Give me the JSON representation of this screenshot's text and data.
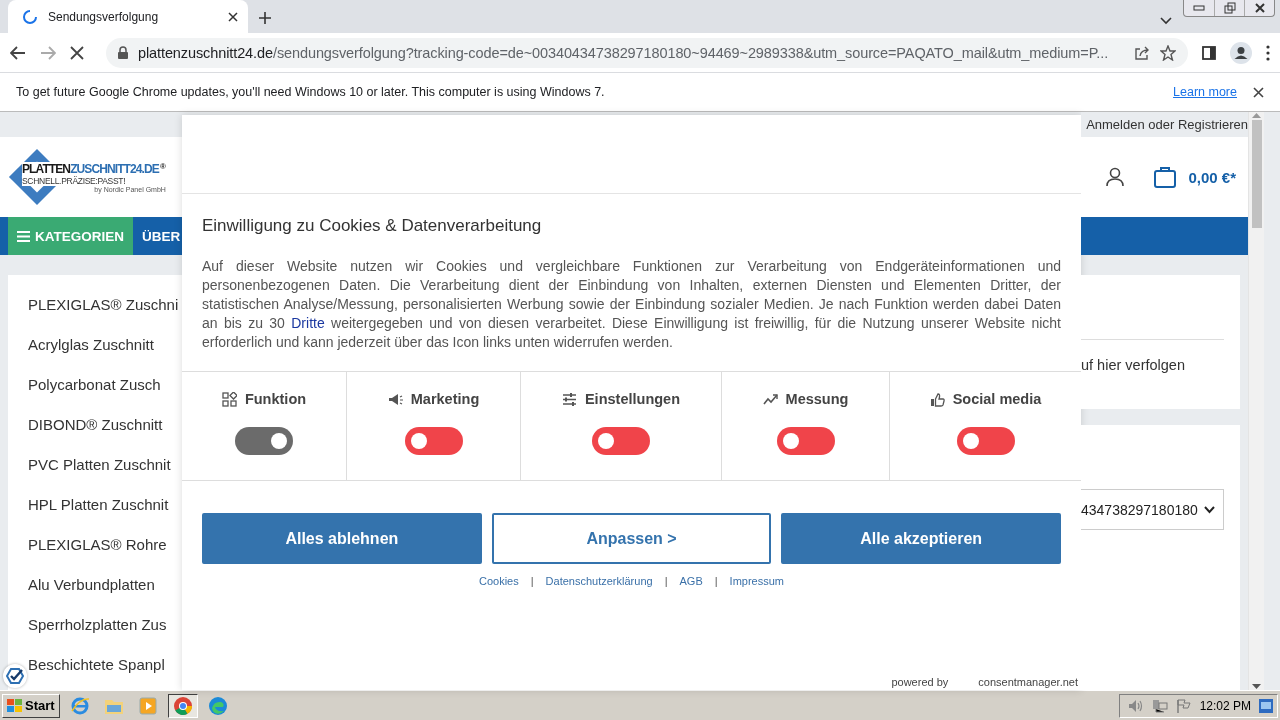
{
  "browser": {
    "tab": {
      "title": "Sendungsverfolgung",
      "loading": true
    },
    "address": {
      "host": "plattenzuschnitt24.de",
      "path": "/sendungsverfolgung?tracking-code=de~00340434738297180180~94469~2989338&utm_source=PAQATO_mail&utm_medium=P..."
    },
    "infobar": {
      "message": "To get future Google Chrome updates, you'll need Windows 10 or later. This computer is using Windows 7.",
      "link": "Learn more"
    }
  },
  "site": {
    "top_link": "Anmelden oder Registrieren",
    "logo": {
      "name_dark": "PLATTEN",
      "name_blue": "ZUSCHNITT24.DE",
      "mark": "®",
      "slogan": "SCHNELL.PRÄZISE:PASST!",
      "byline": "by Nordic Panel GmbH"
    },
    "cart_total": "0,00 €*",
    "nav": [
      {
        "label": "KATEGORIEN",
        "kind": "menu"
      },
      {
        "label": "ÜBER",
        "kind": "link"
      }
    ],
    "sidebar": [
      "PLEXIGLAS® Zuschni",
      "Acrylglas Zuschnitt",
      "Polycarbonat Zusch",
      "DIBOND® Zuschnitt",
      "PVC Platten Zuschnit",
      "HPL Platten Zuschnit",
      "PLEXIGLAS® Rohre",
      "Alu Verbundplatten",
      "Sperrholzplatten Zus",
      "Beschichtete Spanpl"
    ],
    "tracking_text": "uf hier verfolgen",
    "tracking_select": "434738297180180"
  },
  "consent": {
    "title": "Einwilligung zu Cookies & Datenverarbeitung",
    "body": {
      "before": "Auf dieser Website nutzen wir Cookies und vergleichbare Funktionen zur Verarbeitung von Endgeräteinformationen und personenbezogenen Daten. Die Verarbeitung dient der Einbindung von Inhalten, externen Diensten und Elementen Dritter, der statistischen Analyse/Messung, personalisierten Werbung sowie der Einbindung sozialer Medien. Je nach Funktion werden dabei Daten an bis zu 30 ",
      "link": "Dritte",
      "after": " weitergegeben und von diesen verarbeitet. Diese Einwilligung ist freiwillig, für die Nutzung unserer Website nicht erforderlich und kann jederzeit über das Icon links unten widerrufen werden."
    },
    "categories": [
      {
        "label": "Funktion",
        "on": true
      },
      {
        "label": "Marketing",
        "on": false
      },
      {
        "label": "Einstellungen",
        "on": false
      },
      {
        "label": "Messung",
        "on": false
      },
      {
        "label": "Social media",
        "on": false
      }
    ],
    "buttons": [
      {
        "label": "Alles ablehnen",
        "kind": "primary"
      },
      {
        "label": "Anpassen >",
        "kind": "outline"
      },
      {
        "label": "Alle akzeptieren",
        "kind": "primary"
      }
    ],
    "footer_links": [
      {
        "kind": "link",
        "text": "Cookies"
      },
      {
        "kind": "separator",
        "text": "|"
      },
      {
        "kind": "link",
        "text": "Datenschutzerklärung"
      },
      {
        "kind": "separator",
        "text": "|"
      },
      {
        "kind": "link",
        "text": "AGB"
      },
      {
        "kind": "separator",
        "text": "|"
      },
      {
        "kind": "link",
        "text": "Impressum"
      }
    ],
    "powered_by": "powered by",
    "provider": "consentmanager.net"
  },
  "taskbar": {
    "start": "Start",
    "time": "12:02 PM"
  }
}
